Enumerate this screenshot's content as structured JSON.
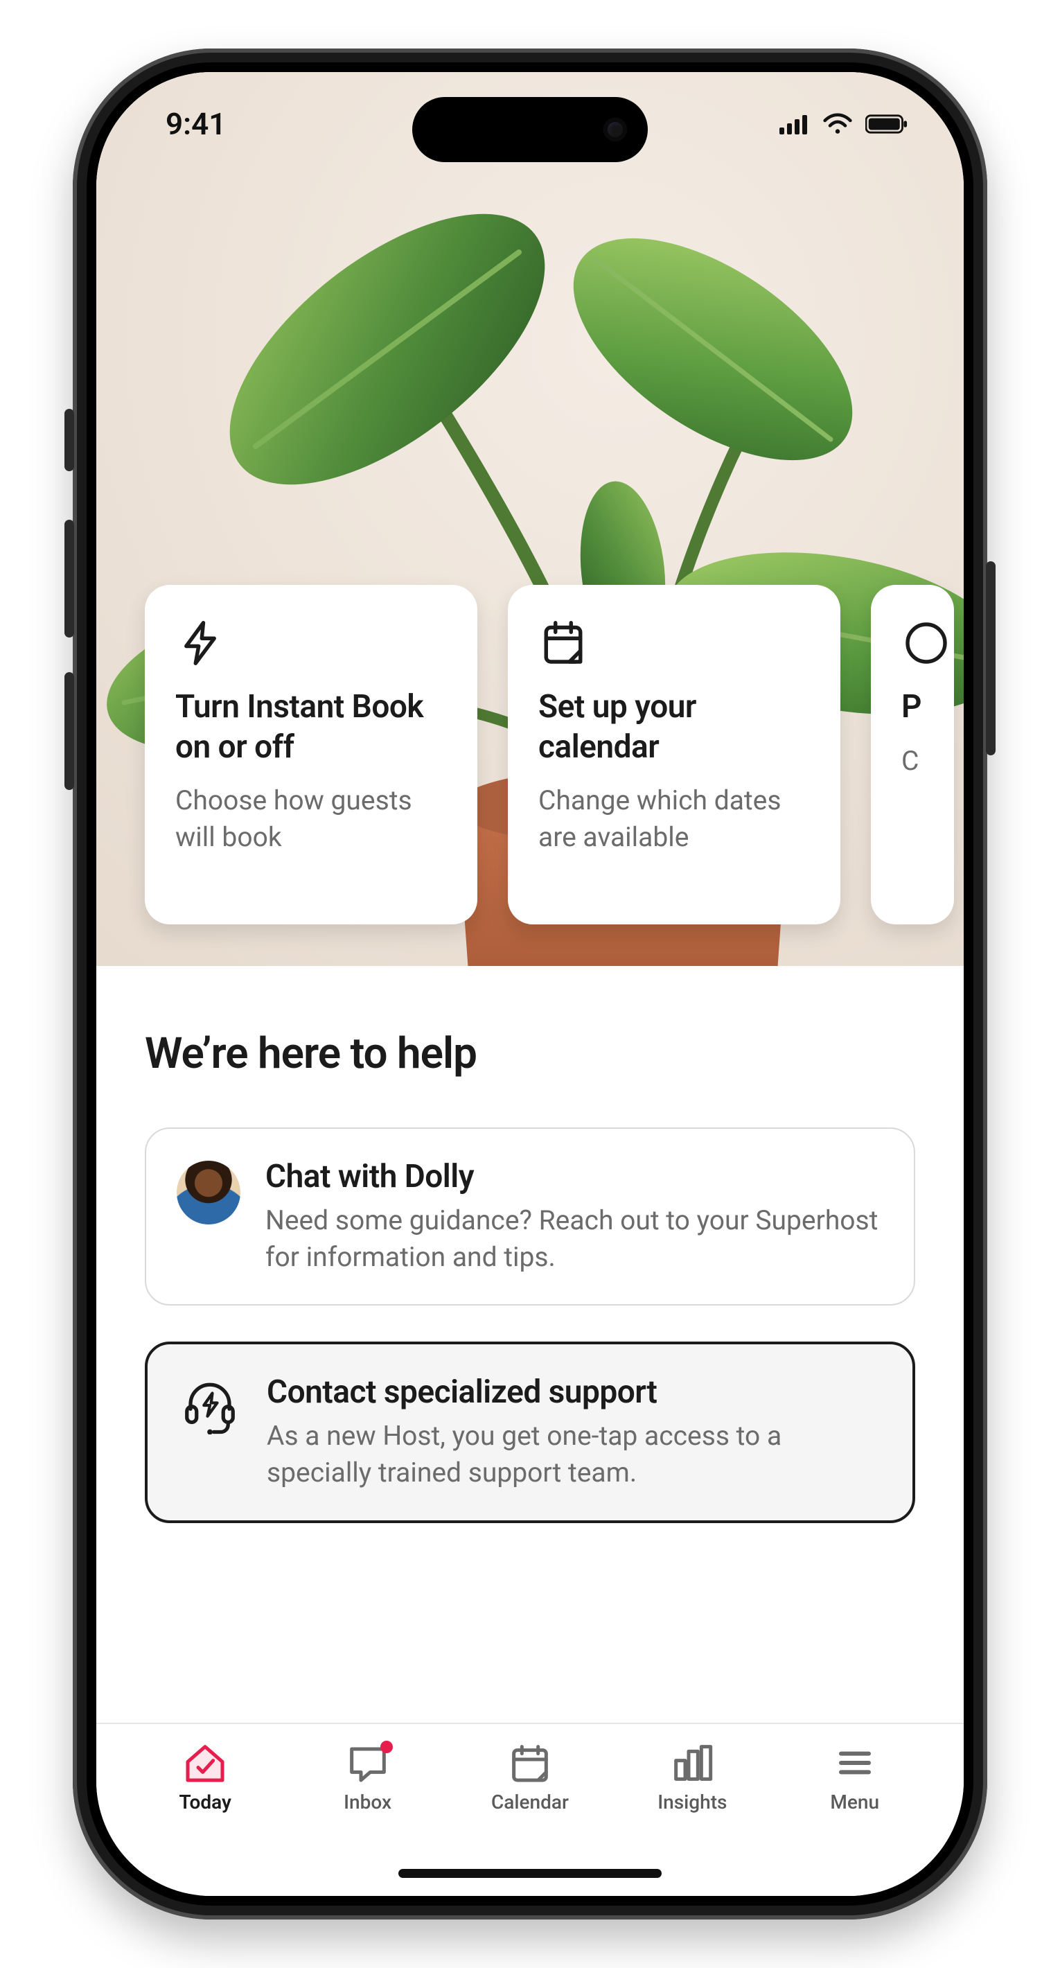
{
  "status": {
    "time": "9:41"
  },
  "hero": {
    "cards": [
      {
        "icon": "bolt-icon",
        "title": "Turn Instant Book on or off",
        "subtitle": "Choose how guests will book"
      },
      {
        "icon": "calendar-fold-icon",
        "title": "Set up your calendar",
        "subtitle": "Change which dates are available"
      },
      {
        "icon": "peek-icon",
        "title": "P",
        "subtitle": "C"
      }
    ]
  },
  "help": {
    "heading": "We’re here to help",
    "chat": {
      "title": "Chat with Dolly",
      "body": "Need some guidance? Reach out to your Superhost for information and tips."
    },
    "support": {
      "title": "Contact specialized support",
      "body": "As a new Host, you get one-tap access to a specially trained support team."
    }
  },
  "tabs": [
    {
      "id": "today",
      "label": "Today",
      "icon": "home-check-icon",
      "active": true,
      "badge": false
    },
    {
      "id": "inbox",
      "label": "Inbox",
      "icon": "chat-icon",
      "active": false,
      "badge": true
    },
    {
      "id": "calendar",
      "label": "Calendar",
      "icon": "calendar-icon",
      "active": false,
      "badge": false
    },
    {
      "id": "insights",
      "label": "Insights",
      "icon": "bars-icon",
      "active": false,
      "badge": false
    },
    {
      "id": "menu",
      "label": "Menu",
      "icon": "menu-icon",
      "active": false,
      "badge": false
    }
  ],
  "colors": {
    "accent": "#e61e4d",
    "text": "#1b1b1b",
    "muted": "#6b6b6b"
  }
}
